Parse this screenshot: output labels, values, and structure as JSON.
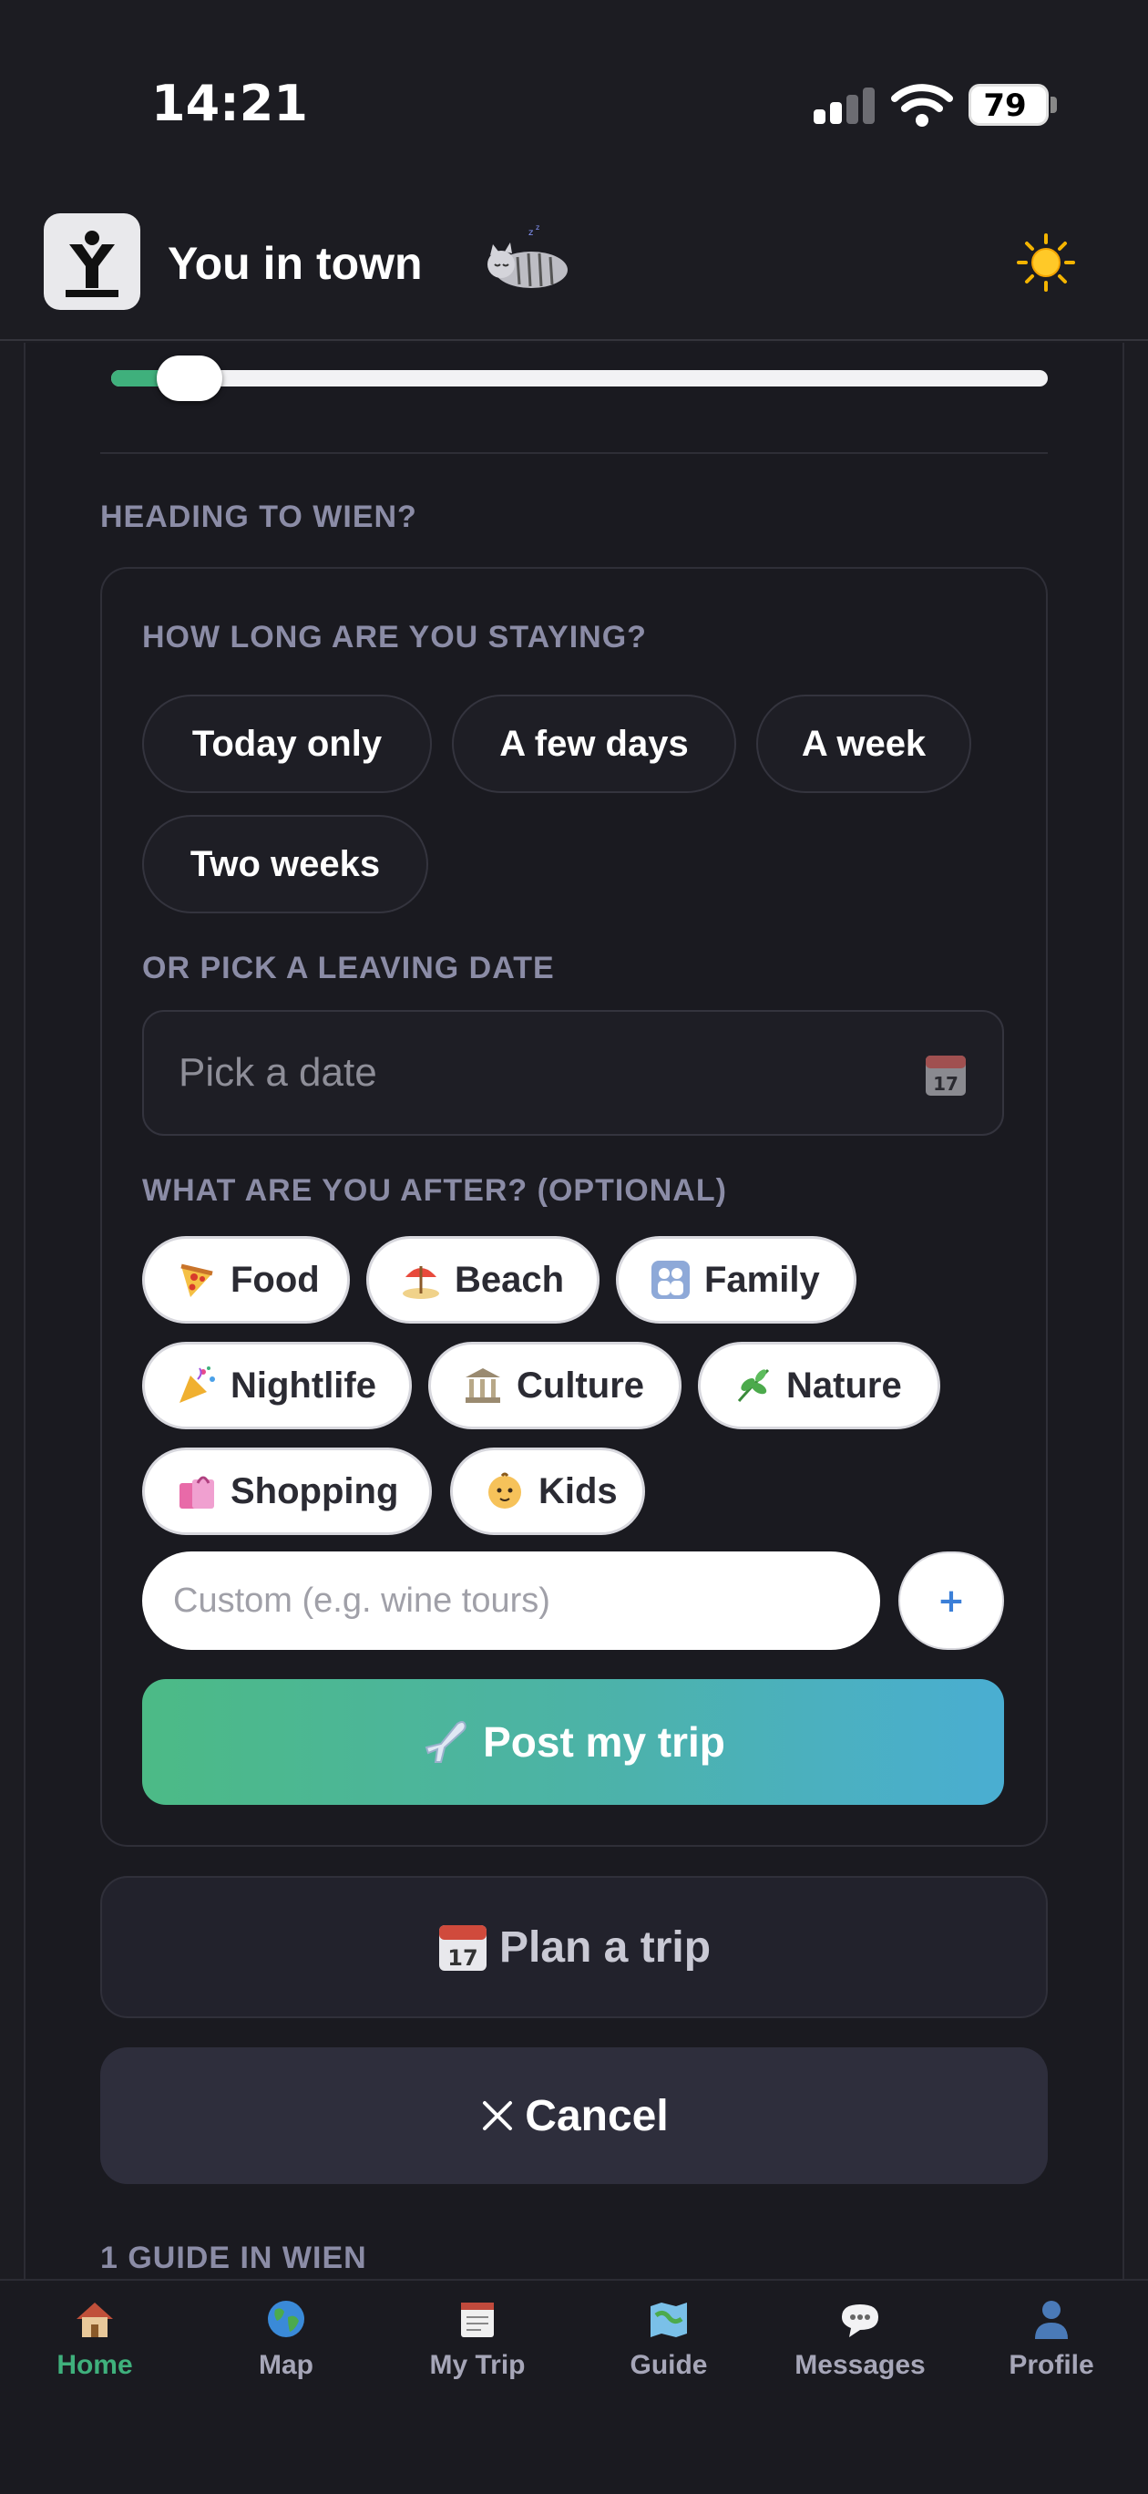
{
  "status_bar": {
    "time": "14:21",
    "battery": "79"
  },
  "header": {
    "title": "You in town",
    "logo_letter": "Y"
  },
  "trip": {
    "heading": "HEADING TO WIEN?",
    "duration_label": "HOW LONG ARE YOU STAYING?",
    "durations": [
      "Today only",
      "A few days",
      "A week",
      "Two weeks"
    ],
    "date_label": "OR PICK A LEAVING DATE",
    "date_placeholder": "Pick a date",
    "interests_label": "WHAT ARE YOU AFTER? (OPTIONAL)",
    "interests": [
      {
        "label": "Food",
        "icon": "pizza-icon"
      },
      {
        "label": "Beach",
        "icon": "beach-umbrella-icon"
      },
      {
        "label": "Family",
        "icon": "family-icon"
      },
      {
        "label": "Nightlife",
        "icon": "party-popper-icon"
      },
      {
        "label": "Culture",
        "icon": "museum-icon"
      },
      {
        "label": "Nature",
        "icon": "herb-icon"
      },
      {
        "label": "Shopping",
        "icon": "shopping-bags-icon"
      },
      {
        "label": "Kids",
        "icon": "baby-icon"
      }
    ],
    "custom_placeholder": "Custom (e.g. wine tours)",
    "add_label": "+",
    "post_label": "Post my trip",
    "plan_label": "Plan a trip",
    "cancel_label": "Cancel"
  },
  "guides_heading": "1 GUIDE IN WIEN",
  "nav": [
    {
      "label": "Home",
      "icon": "house-icon",
      "active": true
    },
    {
      "label": "Map",
      "icon": "globe-icon",
      "active": false
    },
    {
      "label": "My Trip",
      "icon": "notepad-icon",
      "active": false
    },
    {
      "label": "Guide",
      "icon": "map-icon",
      "active": false
    },
    {
      "label": "Messages",
      "icon": "speech-bubble-icon",
      "active": false
    },
    {
      "label": "Profile",
      "icon": "person-icon",
      "active": false
    }
  ],
  "colors": {
    "accent": "#3fb07c",
    "gradient_start": "#4cba86",
    "gradient_end": "#4aaed2",
    "background": "#1c1c22"
  }
}
